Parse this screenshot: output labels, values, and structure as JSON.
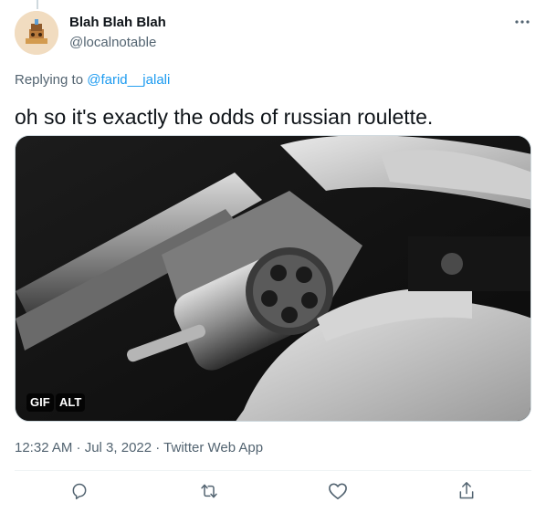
{
  "author": {
    "display_name": "Blah Blah Blah",
    "handle": "@localnotable",
    "avatar_icon": "avatar-cartoon-icon"
  },
  "reply": {
    "prefix": "Replying to ",
    "to_handle": "@farid__jalali"
  },
  "tweet": {
    "text": "oh so it's exactly the odds of russian roulette."
  },
  "media": {
    "gif_badge": "GIF",
    "alt_badge": "ALT",
    "image_icon": "revolver-cylinder-image"
  },
  "timestamp": {
    "text": "12:32 AM · Jul 3, 2022 · Twitter Web App"
  },
  "actions": {
    "icons": [
      "reply-icon",
      "retweet-icon",
      "like-icon",
      "share-icon"
    ]
  },
  "colors": {
    "link": "#1d9bf0",
    "secondary_text": "#536471",
    "primary_text": "#0f1419",
    "divider": "#eff3f4"
  }
}
